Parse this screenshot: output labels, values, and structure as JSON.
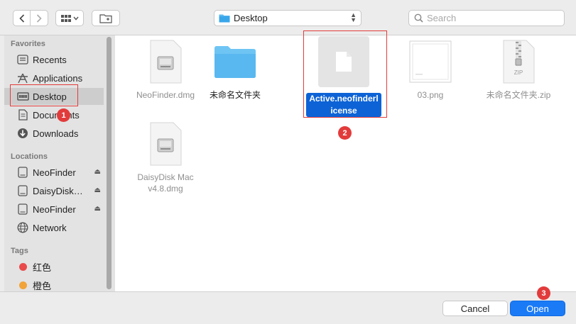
{
  "toolbar": {
    "path_label": "Desktop",
    "search_placeholder": "Search"
  },
  "sidebar": {
    "favorites_header": "Favorites",
    "favorites": [
      {
        "label": "Recents",
        "icon": "clock-icon"
      },
      {
        "label": "Applications",
        "icon": "applications-icon"
      },
      {
        "label": "Desktop",
        "icon": "desktop-icon",
        "selected": true
      },
      {
        "label": "Documents",
        "icon": "document-icon"
      },
      {
        "label": "Downloads",
        "icon": "download-icon"
      }
    ],
    "locations_header": "Locations",
    "locations": [
      {
        "label": "NeoFinder",
        "icon": "drive-icon",
        "ejectable": true
      },
      {
        "label": "DaisyDisk…",
        "icon": "drive-icon",
        "ejectable": true
      },
      {
        "label": "NeoFinder",
        "icon": "drive-icon",
        "ejectable": true
      },
      {
        "label": "Network",
        "icon": "globe-icon"
      }
    ],
    "tags_header": "Tags",
    "tags": [
      {
        "label": "红色",
        "color": "#e94b4b"
      },
      {
        "label": "橙色",
        "color": "#f2a33a"
      }
    ]
  },
  "files": [
    {
      "name": "NeoFinder.dmg",
      "kind": "dmg"
    },
    {
      "name": "未命名文件夹",
      "kind": "folder"
    },
    {
      "name": "Active.neofinderlicense",
      "kind": "document",
      "selected": true
    },
    {
      "name": "03.png",
      "kind": "image"
    },
    {
      "name": "未命名文件夹.zip",
      "kind": "zip",
      "badge_text": "ZIP"
    },
    {
      "name": "DaisyDisk Mac v4.8.dmg",
      "kind": "dmg"
    }
  ],
  "annotations": [
    "1",
    "2",
    "3"
  ],
  "footer": {
    "cancel_label": "Cancel",
    "open_label": "Open"
  },
  "colors": {
    "accent": "#1b7bf6",
    "selection": "#0d63d6",
    "annotation": "#e23b3b",
    "folder": "#5ab8f0"
  }
}
